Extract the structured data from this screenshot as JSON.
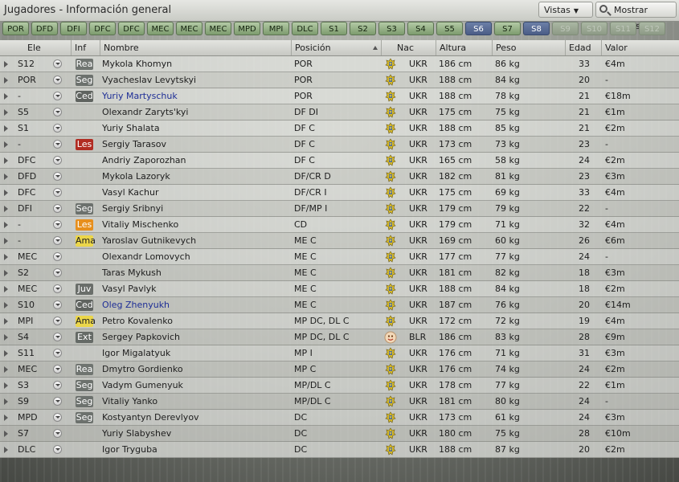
{
  "window": {
    "title": "Jugadores - Información general"
  },
  "toolbar": {
    "views_label": "Vistas",
    "filters_label": "Mostrar Filtros"
  },
  "tabs": [
    {
      "label": "POR",
      "state": "normal"
    },
    {
      "label": "DFD",
      "state": "normal"
    },
    {
      "label": "DFI",
      "state": "normal"
    },
    {
      "label": "DFC",
      "state": "normal"
    },
    {
      "label": "DFC",
      "state": "normal"
    },
    {
      "label": "MEC",
      "state": "normal"
    },
    {
      "label": "MEC",
      "state": "normal"
    },
    {
      "label": "MEC",
      "state": "normal"
    },
    {
      "label": "MPD",
      "state": "normal"
    },
    {
      "label": "MPI",
      "state": "normal"
    },
    {
      "label": "DLC",
      "state": "normal"
    },
    {
      "label": "S1",
      "state": "normal"
    },
    {
      "label": "S2",
      "state": "normal"
    },
    {
      "label": "S3",
      "state": "normal"
    },
    {
      "label": "S4",
      "state": "normal"
    },
    {
      "label": "S5",
      "state": "normal"
    },
    {
      "label": "S6",
      "state": "active"
    },
    {
      "label": "S7",
      "state": "normal"
    },
    {
      "label": "S8",
      "state": "active"
    },
    {
      "label": "S9",
      "state": "faded"
    },
    {
      "label": "S10",
      "state": "faded"
    },
    {
      "label": "S11",
      "state": "faded"
    },
    {
      "label": "S12",
      "state": "faded"
    }
  ],
  "columns": {
    "ele": "Ele",
    "inf": "Inf",
    "nombre": "Nombre",
    "posicion": "Posición",
    "nac": "Nac",
    "altura": "Altura",
    "peso": "Peso",
    "edad": "Edad",
    "valor": "Valor"
  },
  "colors": {
    "accent": "#4b5d86",
    "link": "#1e2e96",
    "badge_les": "#b12c22",
    "badge_les_orange": "#e78f1d",
    "badge_ama": "#ebd64a"
  },
  "players": [
    {
      "ele": "S12",
      "inf": "Rea",
      "nombre": "Mykola Khomyn",
      "pos": "POR",
      "nac": "UKR",
      "alt": "186 cm",
      "peso": "86 kg",
      "edad": "33",
      "valor": "€4m",
      "link": false,
      "flag": "ukraine-crest-icon"
    },
    {
      "ele": "POR",
      "inf": "Seg",
      "nombre": "Vyacheslav Levytskyi",
      "pos": "POR",
      "nac": "UKR",
      "alt": "188 cm",
      "peso": "84 kg",
      "edad": "20",
      "valor": "-",
      "link": false,
      "flag": "ukraine-crest-icon"
    },
    {
      "ele": "-",
      "inf": "Ced",
      "nombre": "Yuriy Martyschuk",
      "pos": "POR",
      "nac": "UKR",
      "alt": "188 cm",
      "peso": "78 kg",
      "edad": "21",
      "valor": "€18m",
      "link": true,
      "flag": "ukraine-crest-icon"
    },
    {
      "ele": "S5",
      "inf": "",
      "nombre": "Olexandr Zaryts'kyi",
      "pos": "DF DI",
      "nac": "UKR",
      "alt": "175 cm",
      "peso": "75 kg",
      "edad": "21",
      "valor": "€1m",
      "link": false,
      "flag": "ukraine-crest-icon"
    },
    {
      "ele": "S1",
      "inf": "",
      "nombre": "Yuriy Shalata",
      "pos": "DF C",
      "nac": "UKR",
      "alt": "188 cm",
      "peso": "85 kg",
      "edad": "21",
      "valor": "€2m",
      "link": false,
      "flag": "ukraine-crest-icon"
    },
    {
      "ele": "-",
      "inf": "Les",
      "nombre": "Sergiy Tarasov",
      "pos": "DF C",
      "nac": "UKR",
      "alt": "173 cm",
      "peso": "73 kg",
      "edad": "23",
      "valor": "-",
      "link": false,
      "flag": "ukraine-crest-icon",
      "badge": "b-Les"
    },
    {
      "ele": "DFC",
      "inf": "",
      "nombre": "Andriy Zaporozhan",
      "pos": "DF C",
      "nac": "UKR",
      "alt": "165 cm",
      "peso": "58 kg",
      "edad": "24",
      "valor": "€2m",
      "link": false,
      "flag": "ukraine-crest-icon"
    },
    {
      "ele": "DFD",
      "inf": "",
      "nombre": "Mykola Lazoryk",
      "pos": "DF/CR D",
      "nac": "UKR",
      "alt": "182 cm",
      "peso": "81 kg",
      "edad": "23",
      "valor": "€3m",
      "link": false,
      "flag": "ukraine-crest-icon"
    },
    {
      "ele": "DFC",
      "inf": "",
      "nombre": "Vasyl Kachur",
      "pos": "DF/CR I",
      "nac": "UKR",
      "alt": "175 cm",
      "peso": "69 kg",
      "edad": "33",
      "valor": "€4m",
      "link": false,
      "flag": "ukraine-crest-icon"
    },
    {
      "ele": "DFI",
      "inf": "Seg",
      "nombre": "Sergiy Sribnyi",
      "pos": "DF/MP I",
      "nac": "UKR",
      "alt": "179 cm",
      "peso": "79 kg",
      "edad": "22",
      "valor": "-",
      "link": false,
      "flag": "ukraine-crest-icon"
    },
    {
      "ele": "-",
      "inf": "Les",
      "nombre": "Vitaliy Mischenko",
      "pos": "CD",
      "nac": "UKR",
      "alt": "179 cm",
      "peso": "71 kg",
      "edad": "32",
      "valor": "€4m",
      "link": false,
      "flag": "ukraine-crest-icon",
      "badge": "b-Les2"
    },
    {
      "ele": "-",
      "inf": "Ama",
      "nombre": "Yaroslav Gutnikevych",
      "pos": "ME C",
      "nac": "UKR",
      "alt": "169 cm",
      "peso": "60 kg",
      "edad": "26",
      "valor": "€6m",
      "link": false,
      "flag": "ukraine-crest-icon"
    },
    {
      "ele": "MEC",
      "inf": "",
      "nombre": "Olexandr Lomovych",
      "pos": "ME C",
      "nac": "UKR",
      "alt": "177 cm",
      "peso": "77 kg",
      "edad": "24",
      "valor": "-",
      "link": false,
      "flag": "ukraine-crest-icon"
    },
    {
      "ele": "S2",
      "inf": "",
      "nombre": "Taras Mykush",
      "pos": "ME C",
      "nac": "UKR",
      "alt": "181 cm",
      "peso": "82 kg",
      "edad": "18",
      "valor": "€3m",
      "link": false,
      "flag": "ukraine-crest-icon"
    },
    {
      "ele": "MEC",
      "inf": "Juv",
      "nombre": "Vasyl Pavlyk",
      "pos": "ME C",
      "nac": "UKR",
      "alt": "188 cm",
      "peso": "84 kg",
      "edad": "18",
      "valor": "€2m",
      "link": false,
      "flag": "ukraine-crest-icon"
    },
    {
      "ele": "S10",
      "inf": "Ced",
      "nombre": "Oleg Zhenyukh",
      "pos": "ME C",
      "nac": "UKR",
      "alt": "187 cm",
      "peso": "76 kg",
      "edad": "20",
      "valor": "€14m",
      "link": true,
      "flag": "ukraine-crest-icon"
    },
    {
      "ele": "MPI",
      "inf": "Ama",
      "nombre": "Petro Kovalenko",
      "pos": "MP DC, DL C",
      "nac": "UKR",
      "alt": "172 cm",
      "peso": "72 kg",
      "edad": "19",
      "valor": "€4m",
      "link": false,
      "flag": "ukraine-crest-icon"
    },
    {
      "ele": "S4",
      "inf": "Ext",
      "nombre": "Sergey Papkovich",
      "pos": "MP DC, DL C",
      "nac": "BLR",
      "alt": "186 cm",
      "peso": "83 kg",
      "edad": "28",
      "valor": "€9m",
      "link": false,
      "flag": "belarus-crest-icon"
    },
    {
      "ele": "S11",
      "inf": "",
      "nombre": "Igor Migalatyuk",
      "pos": "MP I",
      "nac": "UKR",
      "alt": "176 cm",
      "peso": "71 kg",
      "edad": "31",
      "valor": "€3m",
      "link": false,
      "flag": "ukraine-crest-icon"
    },
    {
      "ele": "MEC",
      "inf": "Rea",
      "nombre": "Dmytro Gordienko",
      "pos": "MP C",
      "nac": "UKR",
      "alt": "176 cm",
      "peso": "74 kg",
      "edad": "24",
      "valor": "€2m",
      "link": false,
      "flag": "ukraine-crest-icon"
    },
    {
      "ele": "S3",
      "inf": "Seg",
      "nombre": "Vadym Gumenyuk",
      "pos": "MP/DL C",
      "nac": "UKR",
      "alt": "178 cm",
      "peso": "77 kg",
      "edad": "22",
      "valor": "€1m",
      "link": false,
      "flag": "ukraine-crest-icon"
    },
    {
      "ele": "S9",
      "inf": "Seg",
      "nombre": "Vitaliy Yanko",
      "pos": "MP/DL C",
      "nac": "UKR",
      "alt": "181 cm",
      "peso": "80 kg",
      "edad": "24",
      "valor": "-",
      "link": false,
      "flag": "ukraine-crest-icon"
    },
    {
      "ele": "MPD",
      "inf": "Seg",
      "nombre": "Kostyantyn Derevlyov",
      "pos": "DC",
      "nac": "UKR",
      "alt": "173 cm",
      "peso": "61 kg",
      "edad": "24",
      "valor": "€3m",
      "link": false,
      "flag": "ukraine-crest-icon"
    },
    {
      "ele": "S7",
      "inf": "",
      "nombre": "Yuriy Slabyshev",
      "pos": "DC",
      "nac": "UKR",
      "alt": "180 cm",
      "peso": "75 kg",
      "edad": "28",
      "valor": "€10m",
      "link": false,
      "flag": "ukraine-crest-icon"
    },
    {
      "ele": "DLC",
      "inf": "",
      "nombre": "Igor Tryguba",
      "pos": "DC",
      "nac": "UKR",
      "alt": "188 cm",
      "peso": "87 kg",
      "edad": "20",
      "valor": "€2m",
      "link": false,
      "flag": "ukraine-crest-icon"
    }
  ]
}
